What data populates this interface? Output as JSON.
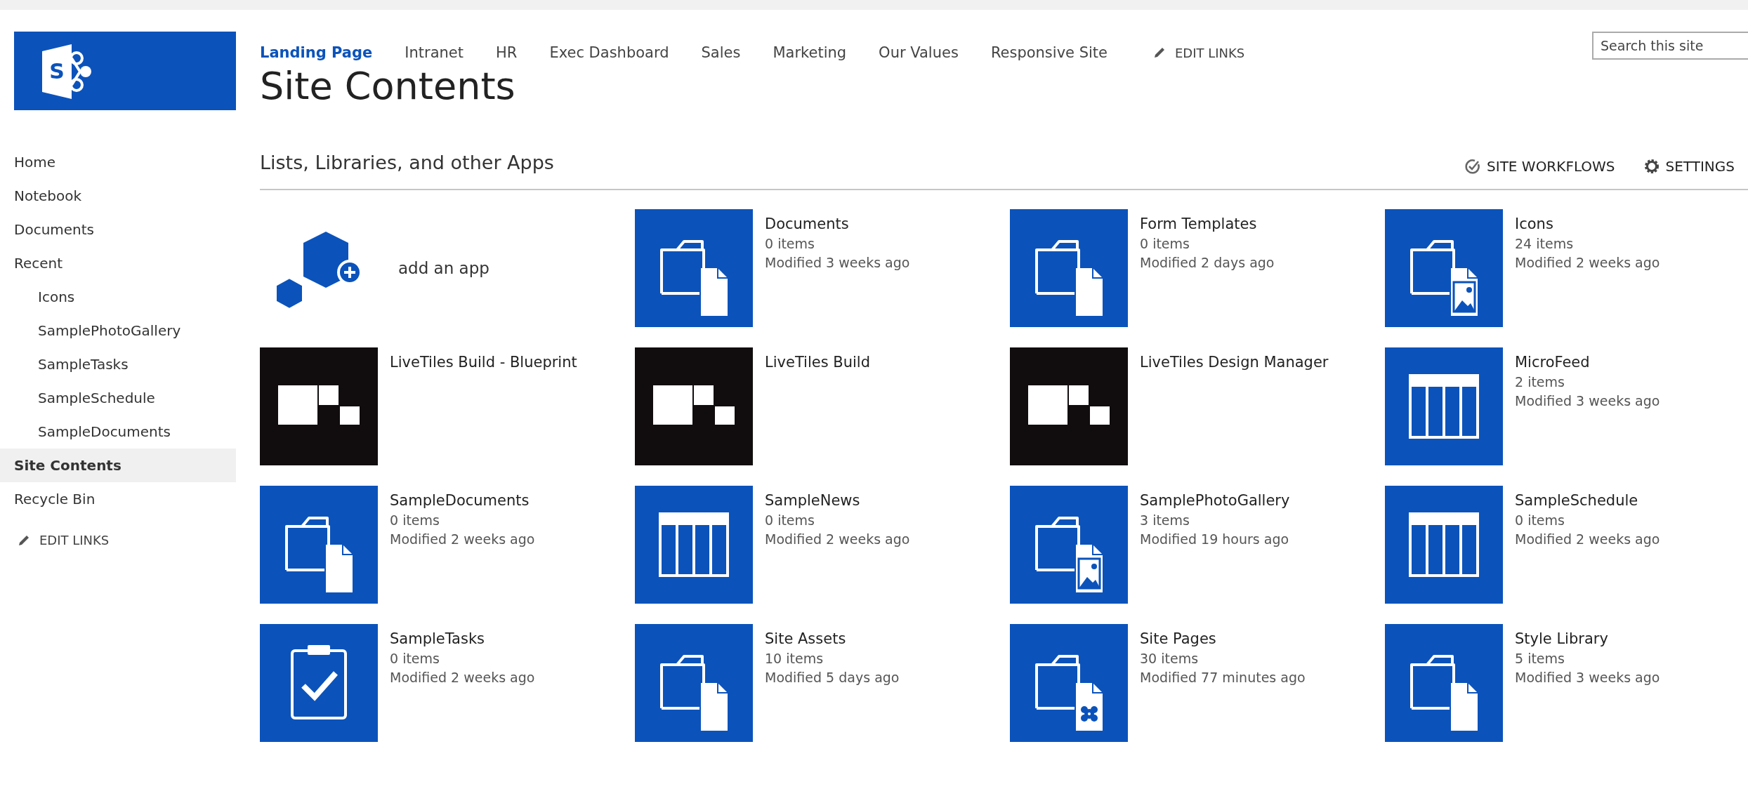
{
  "logo": {
    "letter": "S"
  },
  "top_nav": {
    "links": [
      {
        "label": "Landing Page",
        "selected": true
      },
      {
        "label": "Intranet",
        "selected": false
      },
      {
        "label": "HR",
        "selected": false
      },
      {
        "label": "Exec Dashboard",
        "selected": false
      },
      {
        "label": "Sales",
        "selected": false
      },
      {
        "label": "Marketing",
        "selected": false
      },
      {
        "label": "Our Values",
        "selected": false
      },
      {
        "label": "Responsive Site",
        "selected": false
      }
    ],
    "edit_links": "EDIT LINKS"
  },
  "search": {
    "placeholder": "Search this site"
  },
  "page_title": "Site Contents",
  "sidebar": {
    "items": [
      {
        "label": "Home",
        "selected": false
      },
      {
        "label": "Notebook",
        "selected": false
      },
      {
        "label": "Documents",
        "selected": false
      },
      {
        "label": "Recent",
        "selected": false,
        "children": [
          {
            "label": "Icons",
            "selected": false
          },
          {
            "label": "SamplePhotoGallery",
            "selected": false
          },
          {
            "label": "SampleTasks",
            "selected": false
          },
          {
            "label": "SampleSchedule",
            "selected": false
          },
          {
            "label": "SampleDocuments",
            "selected": false
          }
        ]
      },
      {
        "label": "Site Contents",
        "selected": true
      },
      {
        "label": "Recycle Bin",
        "selected": false
      }
    ],
    "edit_links": "EDIT LINKS"
  },
  "section": {
    "title": "Lists, Libraries, and other Apps",
    "actions": [
      {
        "kind": "workflows",
        "label": "SITE WORKFLOWS"
      },
      {
        "kind": "settings",
        "label": "SETTINGS"
      }
    ]
  },
  "add_app": {
    "label": "add an app"
  },
  "tiles": [
    {
      "kind": "document-library",
      "name": "Documents",
      "count": "0 items",
      "modified": "Modified 3 weeks ago"
    },
    {
      "kind": "document-library",
      "name": "Form Templates",
      "count": "0 items",
      "modified": "Modified 2 days ago"
    },
    {
      "kind": "picture-library",
      "name": "Icons",
      "count": "24 items",
      "modified": "Modified 2 weeks ago"
    },
    {
      "kind": "livetiles",
      "name": "LiveTiles Build - Blueprint"
    },
    {
      "kind": "livetiles",
      "name": "LiveTiles Build"
    },
    {
      "kind": "livetiles",
      "name": "LiveTiles Design Manager"
    },
    {
      "kind": "list",
      "name": "MicroFeed",
      "count": "2 items",
      "modified": "Modified 3 weeks ago"
    },
    {
      "kind": "document-library",
      "name": "SampleDocuments",
      "count": "0 items",
      "modified": "Modified 2 weeks ago"
    },
    {
      "kind": "list",
      "name": "SampleNews",
      "count": "0 items",
      "modified": "Modified 2 weeks ago"
    },
    {
      "kind": "picture-library",
      "name": "SamplePhotoGallery",
      "count": "3 items",
      "modified": "Modified 19 hours ago"
    },
    {
      "kind": "list",
      "name": "SampleSchedule",
      "count": "0 items",
      "modified": "Modified 2 weeks ago"
    },
    {
      "kind": "tasks",
      "name": "SampleTasks",
      "count": "0 items",
      "modified": "Modified 2 weeks ago"
    },
    {
      "kind": "document-library",
      "name": "Site Assets",
      "count": "10 items",
      "modified": "Modified 5 days ago"
    },
    {
      "kind": "pages",
      "name": "Site Pages",
      "count": "30 items",
      "modified": "Modified 77 minutes ago"
    },
    {
      "kind": "document-library",
      "name": "Style Library",
      "count": "5 items",
      "modified": "Modified 3 weeks ago"
    }
  ]
}
